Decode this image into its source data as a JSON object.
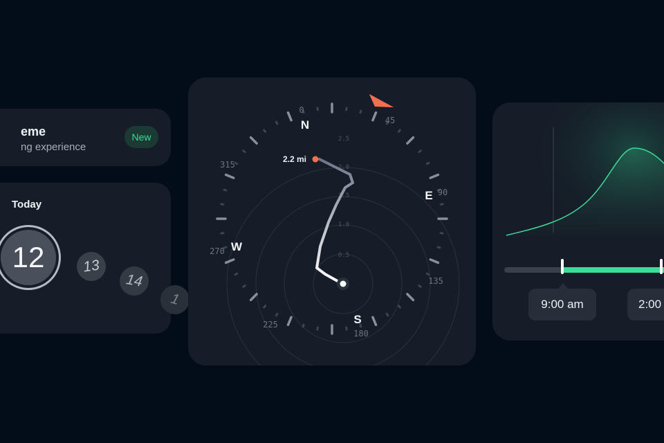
{
  "theme_card": {
    "title": "eme",
    "subtitle": "ng experience",
    "badge": "New"
  },
  "calendar_card": {
    "label": "Today",
    "selected_day": "12",
    "next_days": [
      "13",
      "14",
      "1"
    ]
  },
  "compass_card": {
    "cardinals": {
      "north": "N",
      "east": "E",
      "south": "S",
      "west": "W"
    },
    "bearings": [
      "0",
      "45",
      "90",
      "135",
      "180",
      "225",
      "270",
      "315"
    ],
    "ring_labels": [
      "0.5",
      "1.0",
      "1.5",
      "2.0",
      "2.5"
    ],
    "distance_label": "2.2 mi",
    "colors": {
      "heading_marker": "#f2704f",
      "track": "#c7ccd8",
      "endpoint": "#f2704f"
    }
  },
  "schedule_card": {
    "start_time": "9:00 am",
    "end_time": "2:00",
    "colors": {
      "accent": "#3ddc97",
      "track": "#3a414c"
    }
  }
}
